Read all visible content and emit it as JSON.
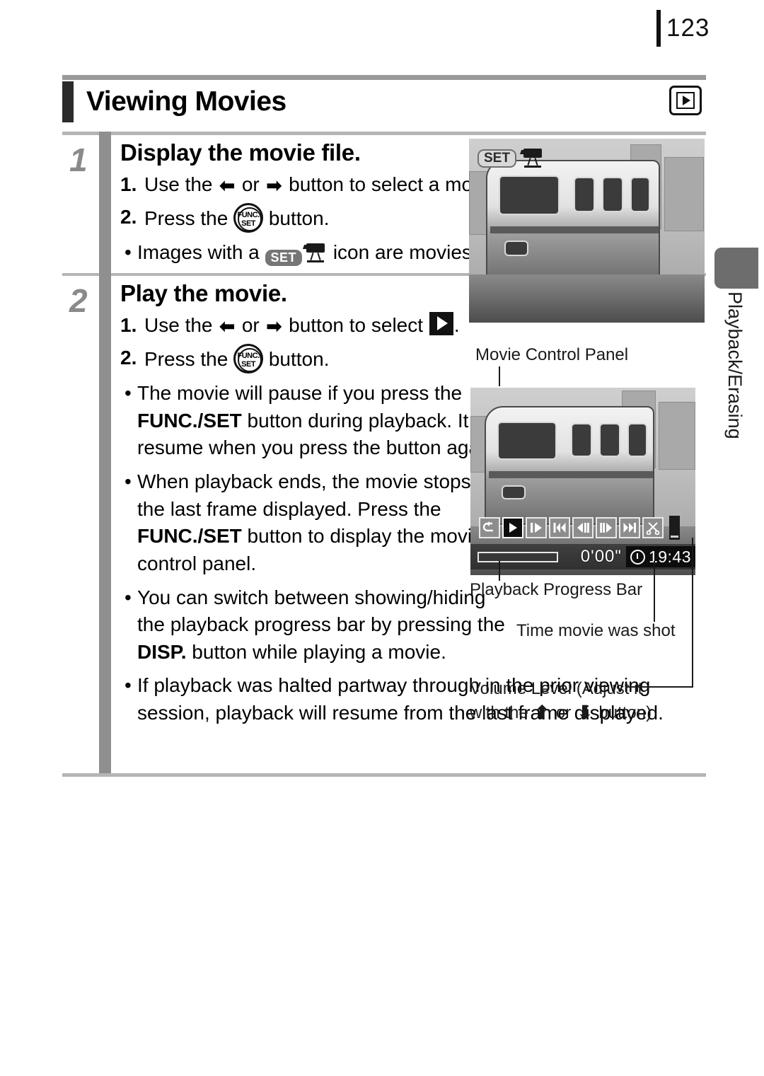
{
  "page": {
    "number": "123"
  },
  "header": {
    "title": "Viewing Movies",
    "mode_icon": "playback-mode-icon"
  },
  "side_tab": {
    "label": "Playback/Erasing"
  },
  "steps": [
    {
      "number": "1",
      "title": "Display the movie file.",
      "substeps": [
        {
          "num": "1.",
          "pre": "Use the ",
          "arrow_left": "⬅",
          "mid": " or ",
          "arrow_right": "➡",
          "post": " button to select a movie."
        },
        {
          "num": "2.",
          "pre": "Press the ",
          "icon": "func-set-button-icon",
          "post": " button."
        }
      ],
      "bullets": [
        {
          "pre": "Images with a ",
          "icon": "movie-set-icon",
          "post": " icon are movies."
        }
      ]
    },
    {
      "number": "2",
      "title": "Play the movie.",
      "substeps": [
        {
          "num": "1.",
          "pre": "Use the ",
          "arrow_left": "⬅",
          "mid": " or ",
          "arrow_right": "➡",
          "post": " button to select ",
          "icon_end": "play-icon",
          "tail": "."
        },
        {
          "num": "2.",
          "pre": "Press the ",
          "icon": "func-set-button-icon",
          "post": " button."
        }
      ],
      "bullets": [
        {
          "segments": [
            {
              "t": "The movie will pause if you press the "
            },
            {
              "t": "FUNC./SET",
              "bold": true
            },
            {
              "t": " button during playback. It will resume when you press the button again."
            }
          ]
        },
        {
          "segments": [
            {
              "t": "When playback ends, the movie stops at the last frame displayed. Press the "
            },
            {
              "t": "FUNC./SET",
              "bold": true
            },
            {
              "t": " button to display the movie control panel."
            }
          ]
        },
        {
          "segments": [
            {
              "t": "You can switch between showing/hiding the playback progress bar by pressing the "
            },
            {
              "t": "DISP.",
              "bold": true
            },
            {
              "t": " button while playing a movie."
            }
          ]
        },
        {
          "segments": [
            {
              "t": "If playback was halted partway through in the prior viewing session, playback will resume from the last frame displayed."
            }
          ]
        }
      ]
    }
  ],
  "photo1": {
    "overlay_badge": "SET",
    "overlay_icon": "movie-camera-icon",
    "alt": "monorail-train-photo"
  },
  "photo2": {
    "alt": "monorail-train-photo-with-controls",
    "control_panel": {
      "buttons": [
        {
          "name": "exit-button",
          "glyph": "↩"
        },
        {
          "name": "play-button",
          "glyph": "▶",
          "selected": true
        },
        {
          "name": "slow-motion-button",
          "glyph": "▐▶"
        },
        {
          "name": "first-frame-button",
          "glyph": "⏮"
        },
        {
          "name": "previous-frame-button",
          "glyph": "◀▐"
        },
        {
          "name": "next-frame-button",
          "glyph": "▐▶"
        },
        {
          "name": "last-frame-button",
          "glyph": "⏭"
        },
        {
          "name": "edit-button",
          "glyph": "✂"
        }
      ],
      "volume_indicator": "volume-level-indicator",
      "elapsed_time": "0'00\"",
      "shot_time": "19:43",
      "clock_icon": "clock-icon"
    }
  },
  "annotations": {
    "movie_control_panel": "Movie Control Panel",
    "playback_progress_bar": "Playback Progress Bar",
    "time_movie_was_shot": "Time movie was shot",
    "volume_line1": "Volume Level (Adjust it",
    "volume_line2_pre": "with the ",
    "volume_arrow_up": "⬆",
    "volume_line2_mid": " or ",
    "volume_arrow_down": "⬇",
    "volume_line2_post": " button)"
  },
  "colors": {
    "spine": "#8f8f8f",
    "rule": "#b5b5b5",
    "step_number": "#8a8a8a",
    "title_bar": "#2c2c2c",
    "side_tab": "#6d6d6d"
  }
}
